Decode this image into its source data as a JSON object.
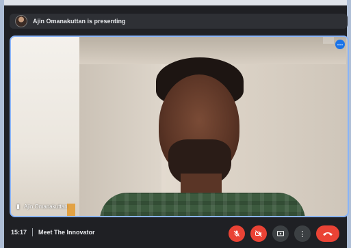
{
  "presenting_banner": {
    "text": "Ajin Omanakuttan is presenting"
  },
  "video_tile": {
    "participant_name": "Ajin Omanakuttan"
  },
  "bottom_bar": {
    "time": "15:17",
    "meeting_title": "Meet The Innovator"
  },
  "icons": {
    "more": "more-options-icon",
    "pin": "pin-icon",
    "mic": "mic-off-icon",
    "camera": "camera-off-icon",
    "present": "present-screen-icon",
    "more_actions": "more-vert-icon",
    "end": "end-call-icon"
  },
  "colors": {
    "accent_blue": "#1a73e8",
    "tile_border": "#8ab4f8",
    "danger_red": "#ea4335",
    "background": "#1f2024"
  }
}
